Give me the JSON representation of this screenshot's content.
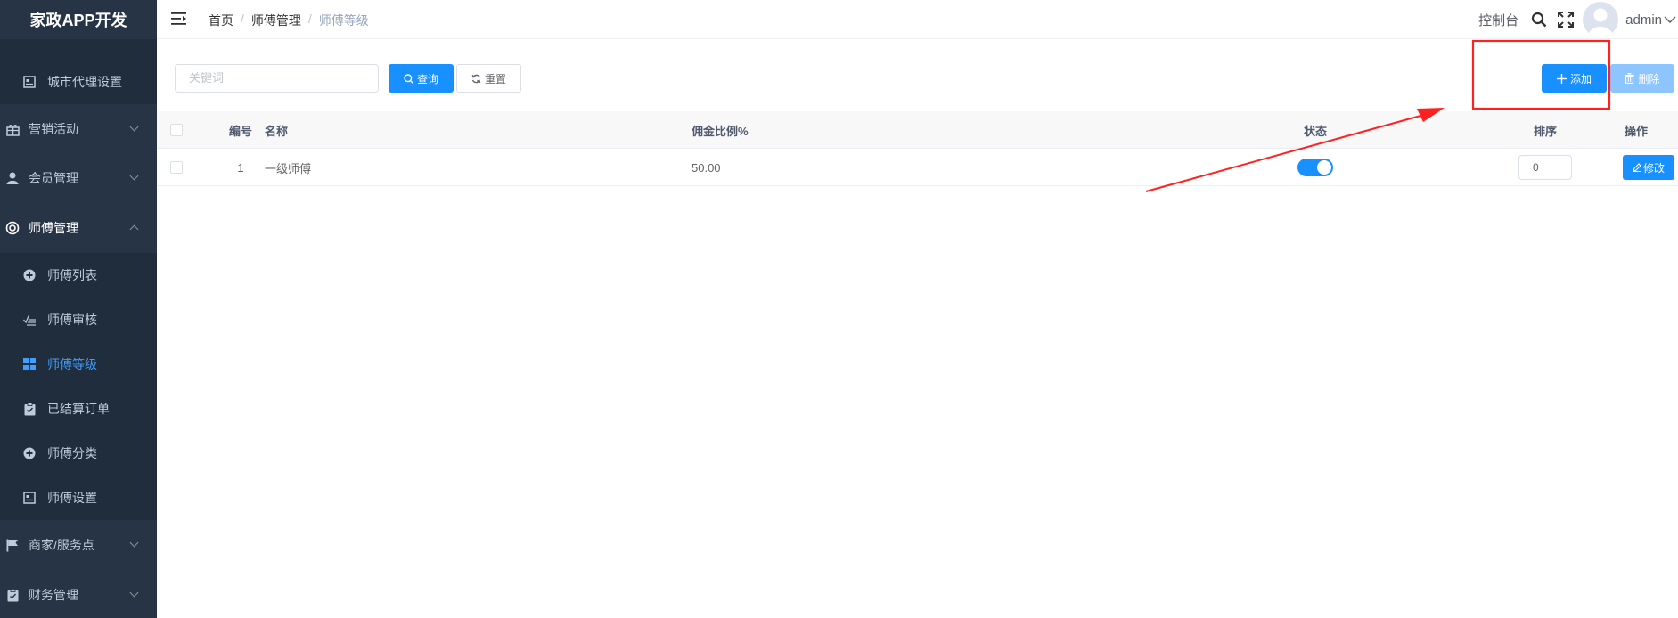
{
  "app": {
    "title": "家政APP开发"
  },
  "sidebar": {
    "items": [
      {
        "label": "城市代理设置",
        "icon": "id-card-icon"
      },
      {
        "label": "营销活动",
        "icon": "gift-icon"
      },
      {
        "label": "会员管理",
        "icon": "user-icon"
      },
      {
        "label": "师傅管理",
        "icon": "lifebuoy-icon"
      },
      {
        "label": "师傅列表",
        "icon": "circle-plus-icon"
      },
      {
        "label": "师傅审核",
        "icon": "check-list-icon"
      },
      {
        "label": "师傅等级",
        "icon": "grid-icon"
      },
      {
        "label": "已结算订单",
        "icon": "clipboard-icon"
      },
      {
        "label": "师傅分类",
        "icon": "circle-plus-icon"
      },
      {
        "label": "师傅设置",
        "icon": "id-card-icon"
      },
      {
        "label": "商家/服务点",
        "icon": "flag-icon"
      },
      {
        "label": "财务管理",
        "icon": "clipboard-icon"
      }
    ]
  },
  "header": {
    "breadcrumb": [
      "首页",
      "师傅管理",
      "师傅等级"
    ],
    "separator": "/",
    "dashboard_label": "控制台",
    "username": "admin"
  },
  "filter": {
    "keyword_placeholder": "关键词",
    "search_label": "查询",
    "reset_label": "重置",
    "add_label": "添加",
    "delete_label": "删除"
  },
  "table": {
    "columns": [
      "编号",
      "名称",
      "佣金比例%",
      "状态",
      "排序",
      "操作"
    ],
    "rows": [
      {
        "id": "1",
        "name": "一级师傅",
        "commission": "50.00",
        "status_on": true,
        "sort": "0",
        "action": "修改"
      }
    ]
  },
  "colors": {
    "sidebar_bg": "#263445",
    "primary": "#1890ff",
    "active": "#409eff",
    "annotation": "#ff2020"
  }
}
